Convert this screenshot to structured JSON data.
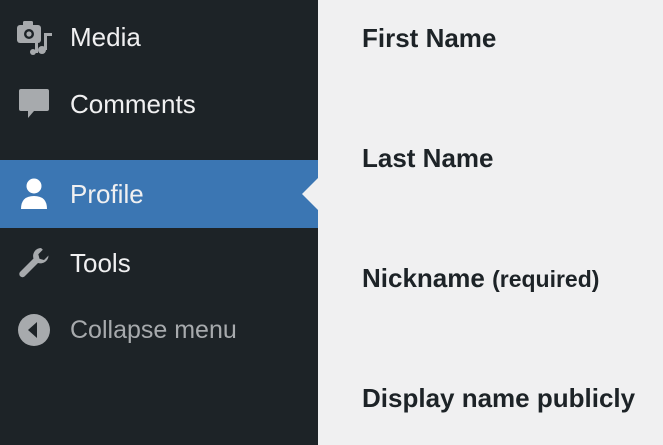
{
  "sidebar": {
    "items": [
      {
        "id": "media",
        "label": "Media",
        "icon": "media-icon"
      },
      {
        "id": "comments",
        "label": "Comments",
        "icon": "comment-bubble-icon"
      },
      {
        "id": "profile",
        "label": "Profile",
        "icon": "user-icon",
        "current": true
      },
      {
        "id": "tools",
        "label": "Tools",
        "icon": "wrench-icon"
      }
    ],
    "collapse": {
      "label": "Collapse menu",
      "icon": "collapse-arrow-icon"
    }
  },
  "form": {
    "first_name_label": "First Name",
    "last_name_label": "Last Name",
    "nickname_label": "Nickname",
    "nickname_required": "(required)",
    "display_name_label": "Display name publicly"
  },
  "colors": {
    "sidebar_bg": "#1d2327",
    "active_bg": "#3b76b3",
    "page_bg": "#f0f0f1",
    "sidebar_text": "#f0f0f1",
    "muted_text": "#a7aaad",
    "heading_text": "#1d2327"
  }
}
